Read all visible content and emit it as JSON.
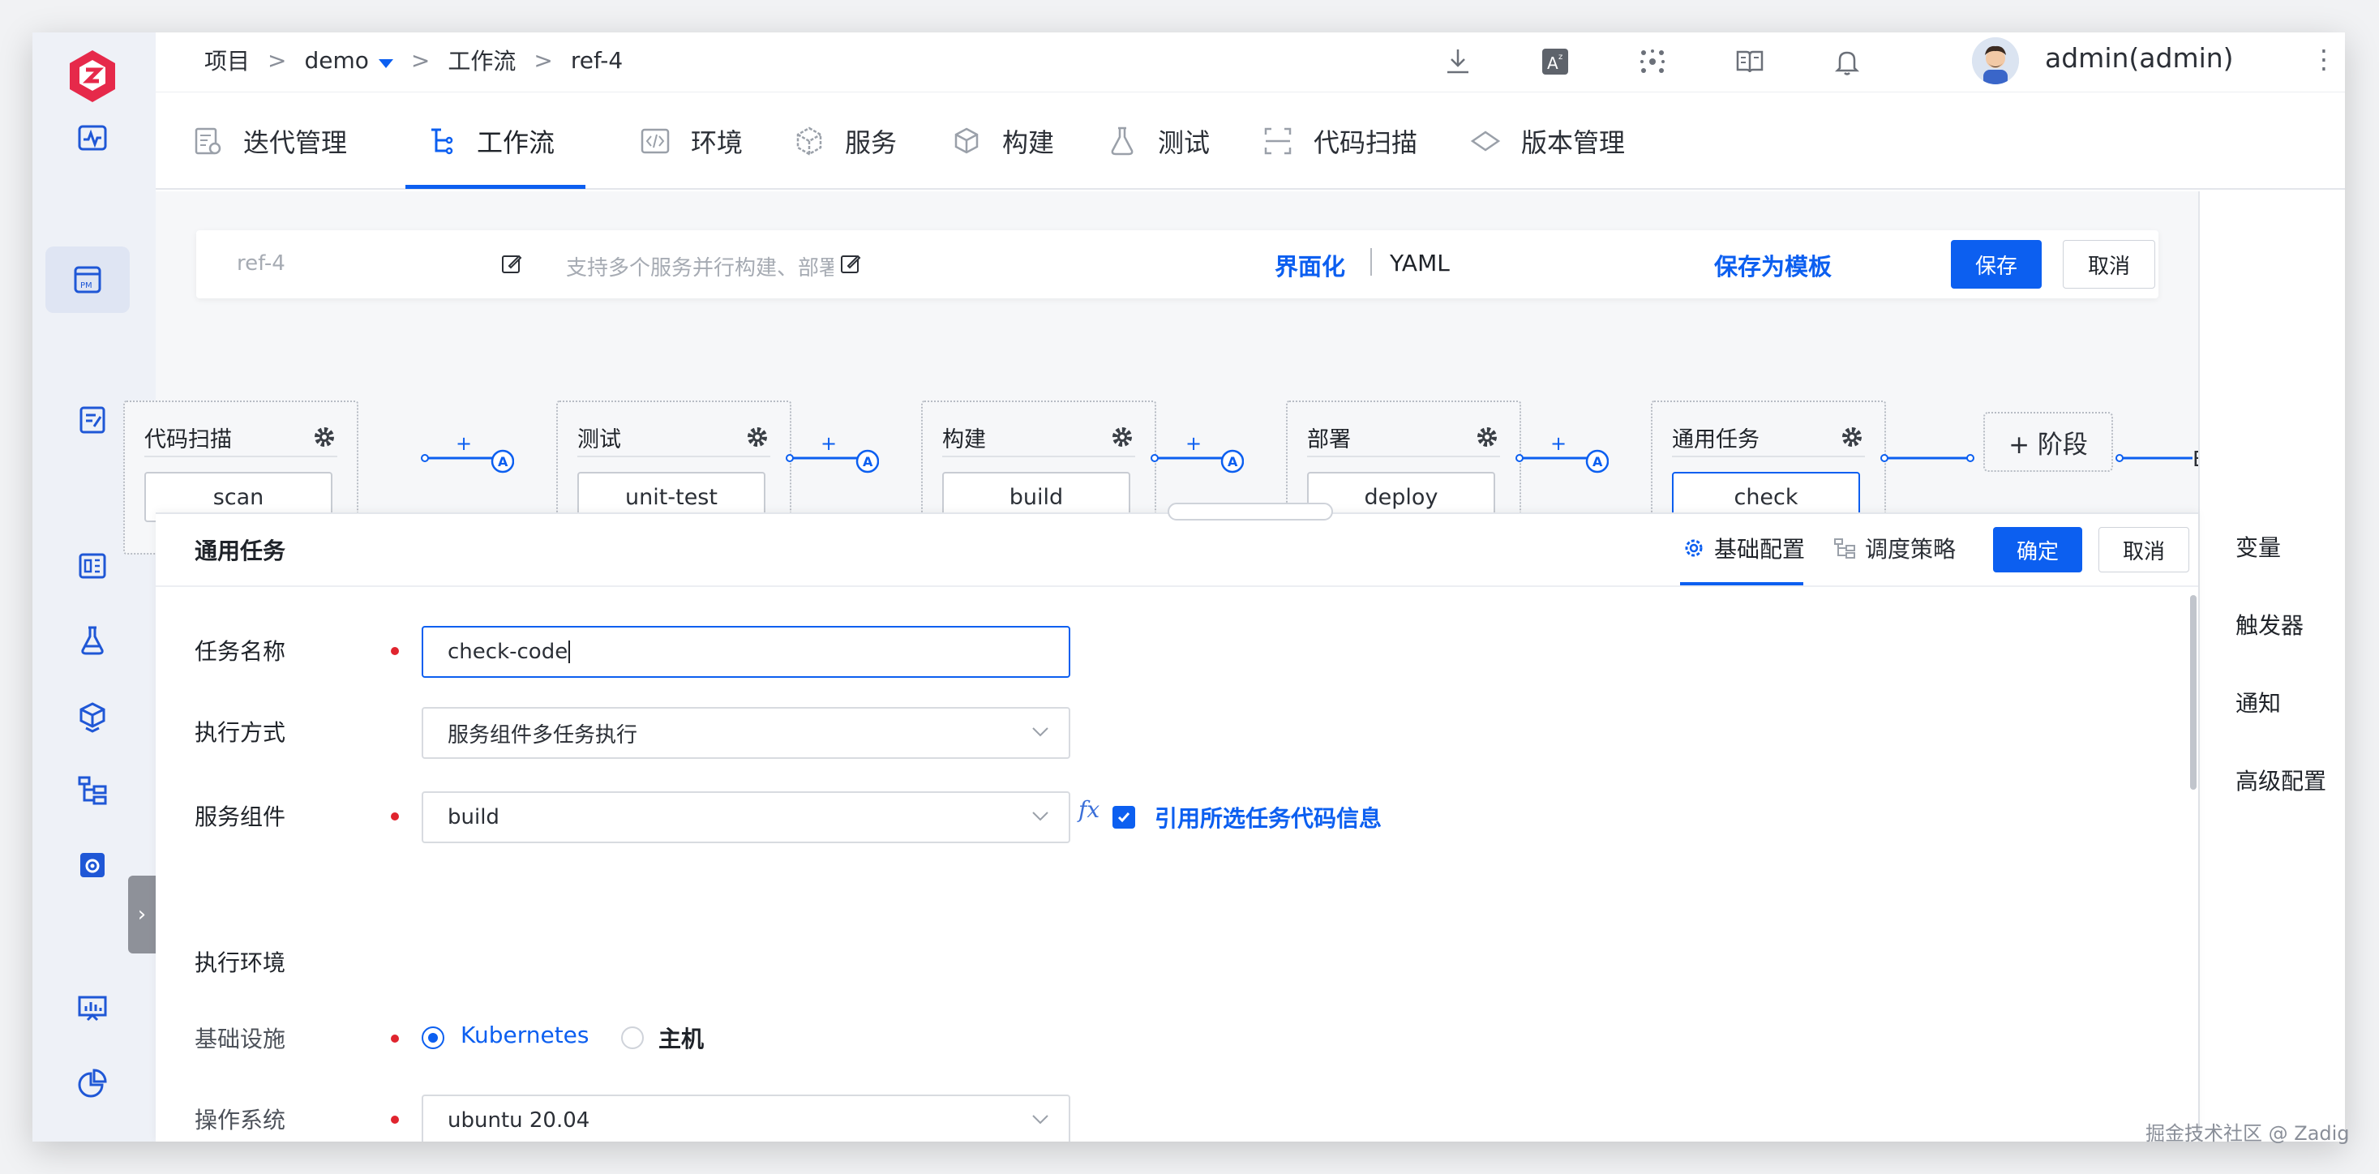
{
  "breadcrumb": {
    "project": "项目",
    "project_name": "demo",
    "workflow": "工作流",
    "workflow_name": "ref-4",
    "sep": ">"
  },
  "user": {
    "name": "admin(admin)"
  },
  "modules": [
    {
      "label": "迭代管理",
      "icon": "iteration-icon"
    },
    {
      "label": "工作流",
      "icon": "workflow-icon"
    },
    {
      "label": "环境",
      "icon": "environment-icon"
    },
    {
      "label": "服务",
      "icon": "service-icon"
    },
    {
      "label": "构建",
      "icon": "build-icon"
    },
    {
      "label": "测试",
      "icon": "test-icon"
    },
    {
      "label": "代码扫描",
      "icon": "code-scan-icon"
    },
    {
      "label": "版本管理",
      "icon": "version-icon"
    }
  ],
  "workflow": {
    "name_placeholder": "ref-4",
    "desc_placeholder": "支持多个服务并行构建、部署",
    "mode_ui": "界面化",
    "mode_yaml": "YAML",
    "save_template": "保存为模板",
    "save": "保存",
    "cancel": "取消"
  },
  "stages": [
    {
      "title": "代码扫描",
      "job": "scan"
    },
    {
      "title": "测试",
      "job": "unit-test"
    },
    {
      "title": "构建",
      "job": "build"
    },
    {
      "title": "部署",
      "job": "deploy"
    },
    {
      "title": "通用任务",
      "job": "check"
    }
  ],
  "connector": {
    "plus": "+",
    "approval": "A",
    "tail": "E"
  },
  "add_stage": "+ 阶段",
  "right_panel": {
    "variables": "变量",
    "triggers": "触发器",
    "notify": "通知",
    "advanced": "高级配置"
  },
  "drawer": {
    "title": "通用任务",
    "tab_basic": "基础配置",
    "tab_schedule": "调度策略",
    "confirm": "确定",
    "cancel": "取消",
    "task_name_label": "任务名称",
    "task_name_value": "check-code",
    "exec_mode_label": "执行方式",
    "exec_mode_value": "服务组件多任务执行",
    "service_label": "服务组件",
    "service_value": "build",
    "fx": "fx",
    "ref_code_label": "引用所选任务代码信息",
    "ref_code_checked": true,
    "env_section": "执行环境",
    "infra_label": "基础设施",
    "infra_kubernetes": "Kubernetes",
    "infra_host": "主机",
    "infra_selected": "Kubernetes",
    "os_label": "操作系统",
    "os_value": "ubuntu 20.04"
  },
  "colors": {
    "primary": "#0c5ff0",
    "required": "#e0242e",
    "logo": "#e6294a"
  },
  "watermark": "掘金技术社区 @ Zadig"
}
